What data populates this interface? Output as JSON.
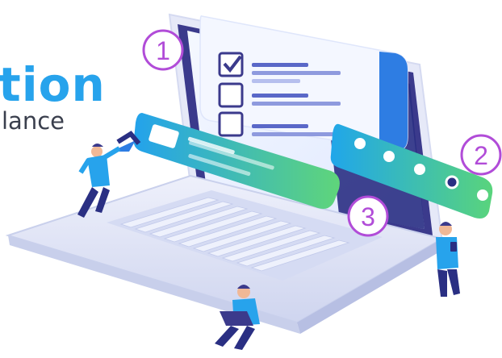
{
  "headline": "tion",
  "subline": "lance",
  "steps": [
    "1",
    "2",
    "3"
  ],
  "checklist": {
    "items": [
      {
        "checked": true
      },
      {
        "checked": false
      },
      {
        "checked": false
      }
    ]
  },
  "colors": {
    "headline": "#27a3ec",
    "subline": "#3a3f4d",
    "step_badge": "#b14cd8",
    "pill_gradient_start": "#23a2ec",
    "pill_gradient_end": "#5fd57a",
    "laptop_body": "#e3e7f7",
    "screen_frame": "#3b3a8c",
    "screen": "#eef3ff"
  },
  "icons": [
    "checkmark-icon",
    "password-dots-icon",
    "laptop-icon"
  ]
}
